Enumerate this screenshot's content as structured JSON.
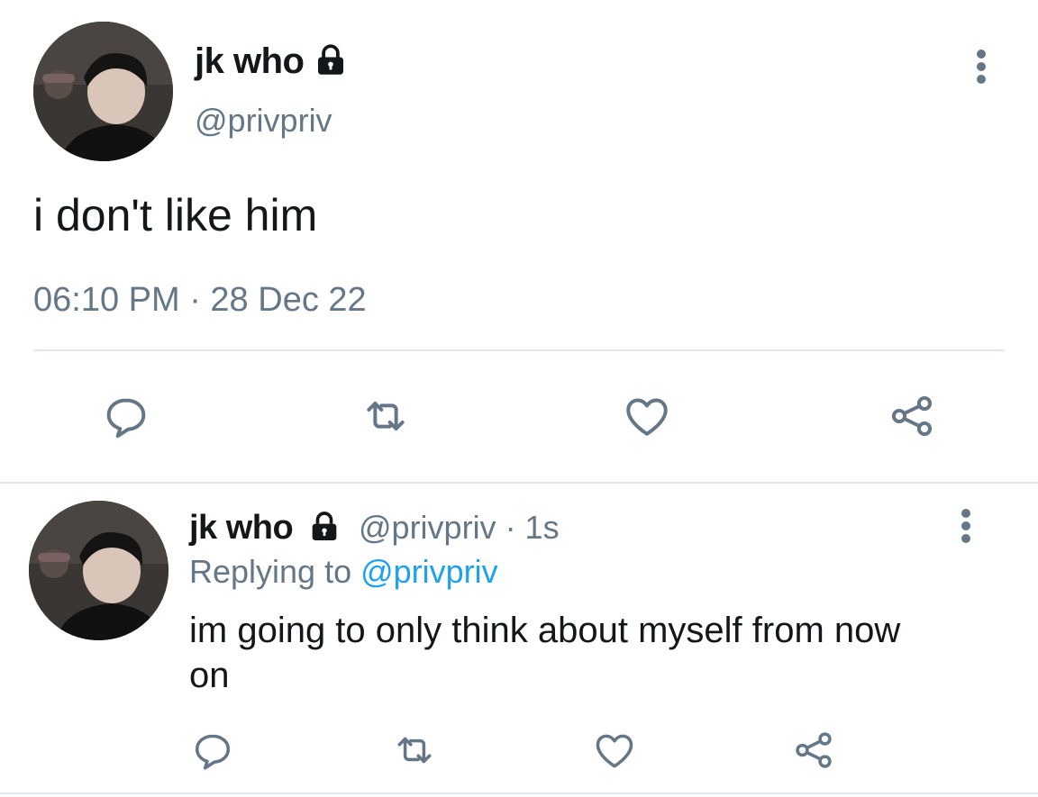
{
  "main_tweet": {
    "display_name": "jk who",
    "handle": "@privpriv",
    "text": "i don't like him",
    "timestamp": "06:10 PM · 28 Dec 22",
    "locked": true,
    "avatar_icon": "profile-photo"
  },
  "reply_tweet": {
    "display_name": "jk who",
    "handle_time": "@privpriv · 1s",
    "replying_prefix": "Replying to ",
    "replying_handle": "@privpriv",
    "text_line1": "im going to only think about myself from now",
    "text_line2": "on",
    "locked": true
  },
  "actions": [
    "reply-icon",
    "retweet-icon",
    "like-icon",
    "share-icon"
  ],
  "colors": {
    "text": "#14171a",
    "muted": "#657786",
    "link": "#1da1f2",
    "divider": "#e1e8ed"
  }
}
